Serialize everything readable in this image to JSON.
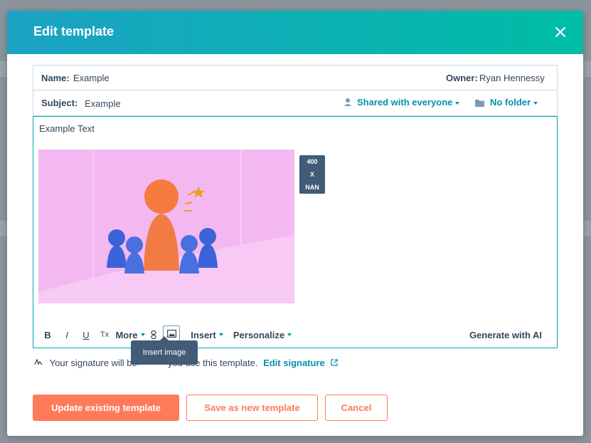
{
  "modal": {
    "title": "Edit template"
  },
  "name_row": {
    "name_label": "Name:",
    "name_value": "Example",
    "owner_label": "Owner:",
    "owner_value": "Ryan Hennessy"
  },
  "subject_row": {
    "subject_label": "Subject:",
    "subject_value": "Example",
    "sharing_label": "Shared with everyone",
    "folder_label": "No folder"
  },
  "editor": {
    "body_text": "Example Text",
    "image_size_width": "400",
    "image_size_sep": "X",
    "image_size_height": "NAN"
  },
  "toolbar": {
    "bold": "B",
    "italic": "I",
    "underline": "U",
    "clear_format": "Tx",
    "more": "More",
    "insert": "Insert",
    "personalize": "Personalize",
    "generate_ai": "Generate with AI"
  },
  "tooltip": {
    "text": "Insert image"
  },
  "signature": {
    "text_before": "Your signature will be",
    "text_after": "you use this template.",
    "edit_link": "Edit signature"
  },
  "buttons": {
    "update": "Update existing template",
    "save_new": "Save as new template",
    "cancel": "Cancel"
  },
  "colors": {
    "header_start": "#1ba2c4",
    "header_end": "#00bda5",
    "accent": "#0091ae",
    "primary_button": "#ff7a59"
  }
}
